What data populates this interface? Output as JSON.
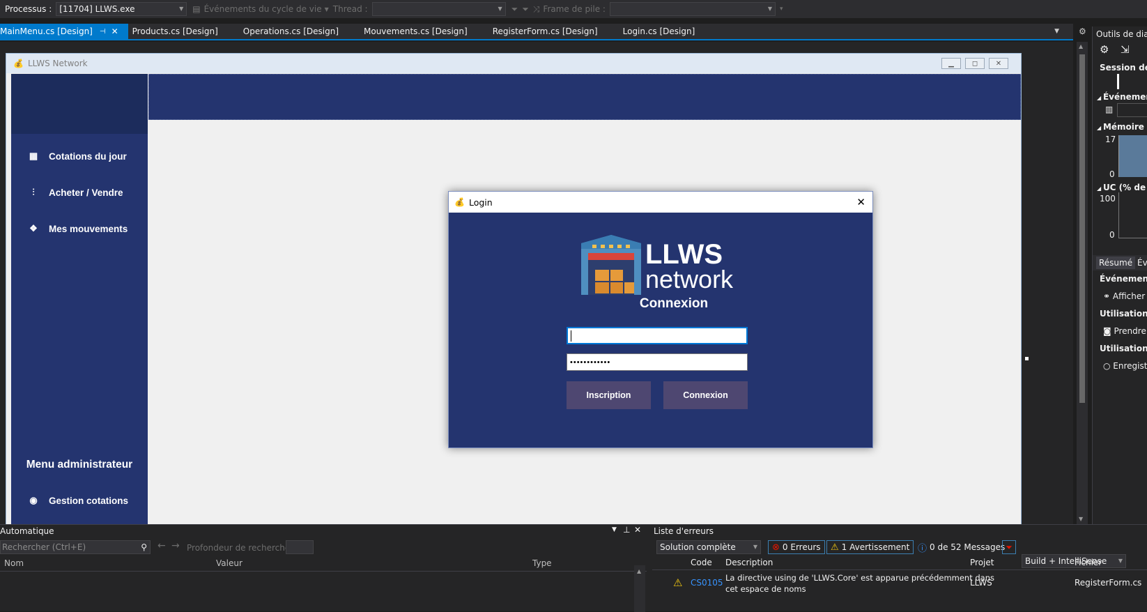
{
  "toolbar": {
    "process_label": "Processus :",
    "process_value": "[11704] LLWS.exe",
    "lifecycle_label": "Événements du cycle de vie",
    "thread_label": "Thread :",
    "thread_value": "",
    "stackframe_label": "Frame de pile :",
    "stackframe_value": ""
  },
  "tabs": [
    {
      "label": "MainMenu.cs [Design]"
    },
    {
      "label": "Products.cs [Design]"
    },
    {
      "label": "Operations.cs [Design]"
    },
    {
      "label": "Mouvements.cs [Design]"
    },
    {
      "label": "RegisterForm.cs [Design]"
    },
    {
      "label": "Login.cs [Design]"
    }
  ],
  "form": {
    "title": "LLWS Network",
    "sidebar_items": [
      {
        "label": "Cotations du jour",
        "icon": "boxes-icon"
      },
      {
        "label": "Acheter / Vendre",
        "icon": "chart-icon"
      },
      {
        "label": "Mes mouvements",
        "icon": "cubes-icon"
      }
    ],
    "admin_title": "Menu administrateur",
    "admin_items": [
      {
        "label": "Gestion cotations",
        "icon": "user-circle-icon"
      }
    ]
  },
  "login": {
    "title": "Login",
    "logo_line1": "LLWS",
    "logo_line2": "network",
    "heading": "Connexion",
    "username_value": "",
    "password_value": "••••••••••••",
    "register_button": "Inscription",
    "login_button": "Connexion"
  },
  "diag": {
    "title": "Outils de diag",
    "session": "Session de d",
    "events": "Événement",
    "memory": "Mémoire d",
    "mem_max": "17",
    "mem_min": "0",
    "cpu": "UC (% de to",
    "cpu_max": "100",
    "cpu_min": "0",
    "tab_summary": "Résumé",
    "tab_events": "Év",
    "events_header": "Événements",
    "show": "Afficher",
    "usage1": "Utilisation de",
    "take": "Prendre",
    "usage2": "Utilisation de",
    "record": "Enregist"
  },
  "autos": {
    "title": "Automatique",
    "search_placeholder": "Rechercher (Ctrl+E)",
    "depth_label": "Profondeur de recherche :",
    "col_name": "Nom",
    "col_value": "Valeur",
    "col_type": "Type"
  },
  "errors": {
    "title": "Liste d'erreurs",
    "scope": "Solution complète",
    "errors_count": "0 Erreurs",
    "warnings_count": "1 Avertissement",
    "messages_count": "0 de 52 Messages",
    "build_filter": "Build + IntelliSense",
    "col_code": "Code",
    "col_description": "Description",
    "col_project": "Projet",
    "col_file": "Fichier",
    "rows": [
      {
        "code": "CS0105",
        "description_1": "La directive using de 'LLWS.Core' est apparue précédemment dans",
        "description_2": "cet espace de noms",
        "project": "LLWS",
        "file": "RegisterForm.cs"
      }
    ]
  }
}
